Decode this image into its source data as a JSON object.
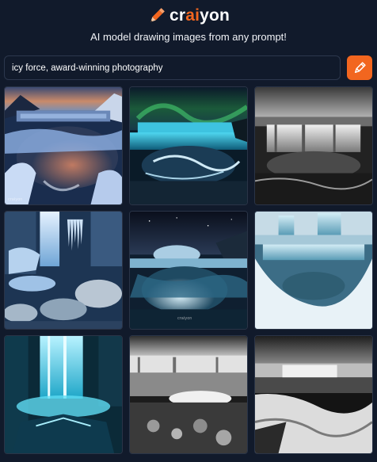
{
  "app": {
    "logo_prefix": "cr",
    "logo_ai": "ai",
    "logo_suffix": "yon",
    "logo_icon": "pencil-icon",
    "tagline": "AI model drawing images from any prompt!",
    "accent_color": "#f2661f",
    "background_color": "#111a2b"
  },
  "prompt": {
    "value": "icy force, award-winning photography",
    "button_icon": "pencil-icon"
  },
  "gallery": {
    "images": [
      {
        "subject": "frozen waterfall at sunset"
      },
      {
        "subject": "waterfall under aurora"
      },
      {
        "subject": "black and white waterfall"
      },
      {
        "subject": "icy waterfall with icicles"
      },
      {
        "subject": "frozen river at night"
      },
      {
        "subject": "icy cascading falls"
      },
      {
        "subject": "blue glowing frozen waterfall"
      },
      {
        "subject": "black and white icy falls"
      },
      {
        "subject": "black and white frozen waterfall"
      }
    ]
  }
}
